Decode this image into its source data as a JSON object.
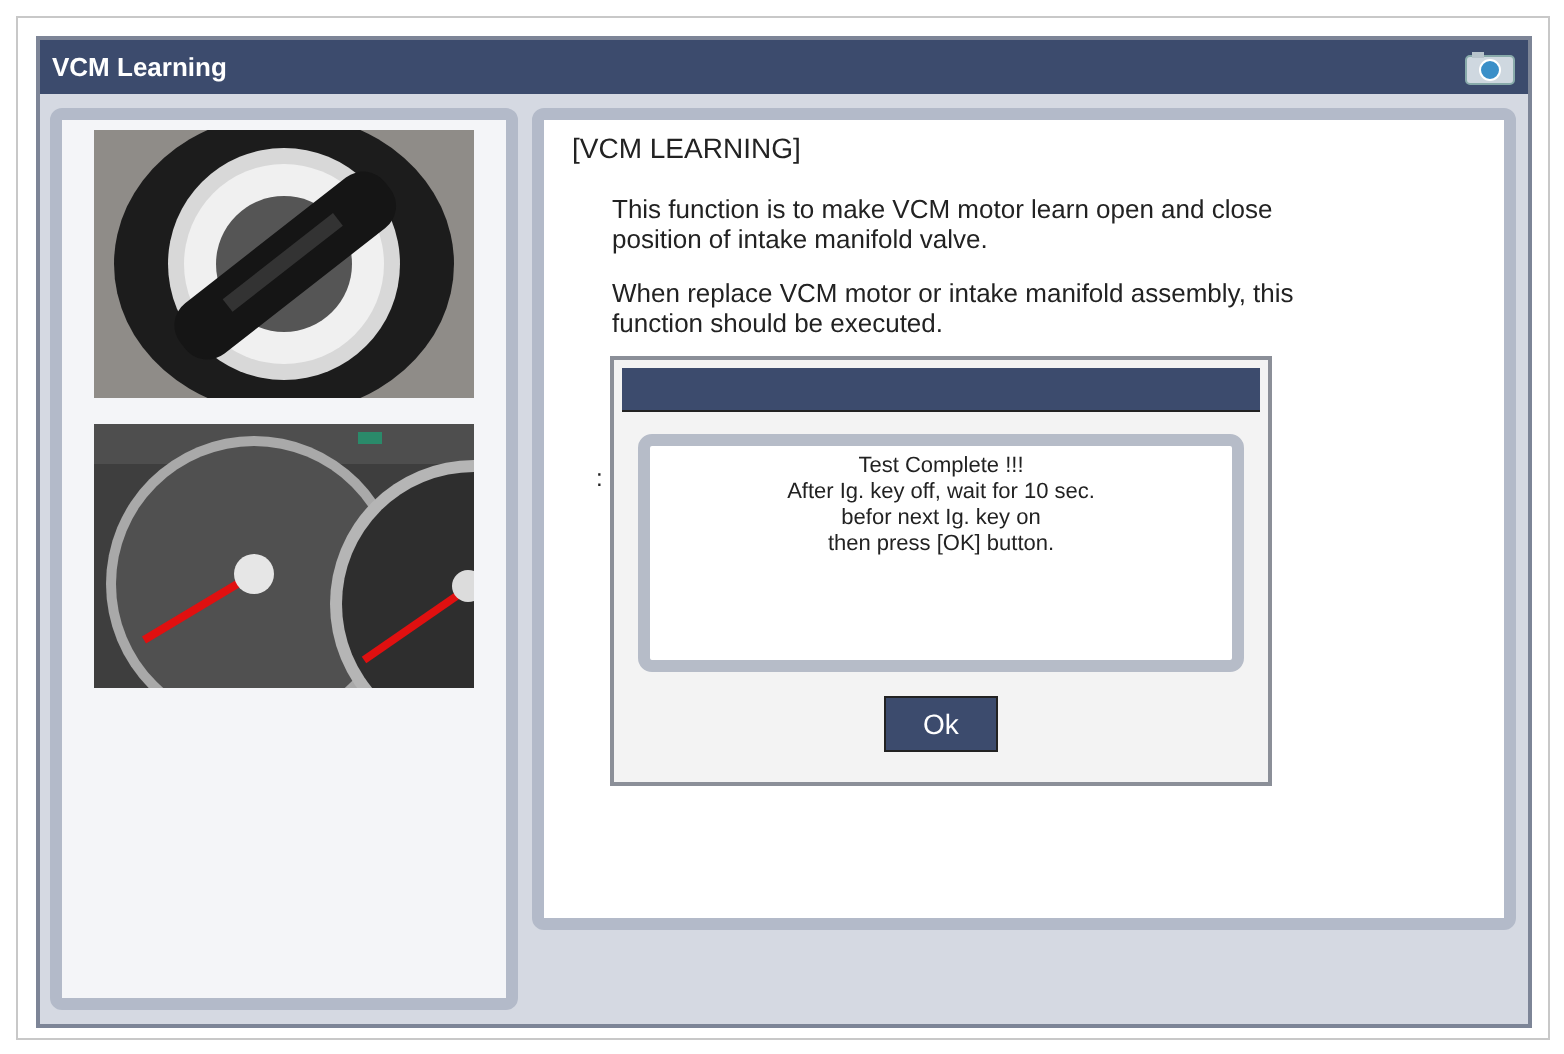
{
  "window": {
    "title": "VCM Learning"
  },
  "content": {
    "heading": "[VCM LEARNING]",
    "paragraphs": [
      "This function is to make VCM motor learn open and close position of intake manifold valve.",
      "When replace VCM motor or intake manifold assembly, this function should be executed."
    ],
    "partial_text": ":"
  },
  "dialog": {
    "message_lines": [
      "Test Complete !!!",
      "After Ig. key off, wait for 10 sec.",
      "befor next Ig. key on",
      "then press [OK] button."
    ],
    "button": "Ok"
  }
}
